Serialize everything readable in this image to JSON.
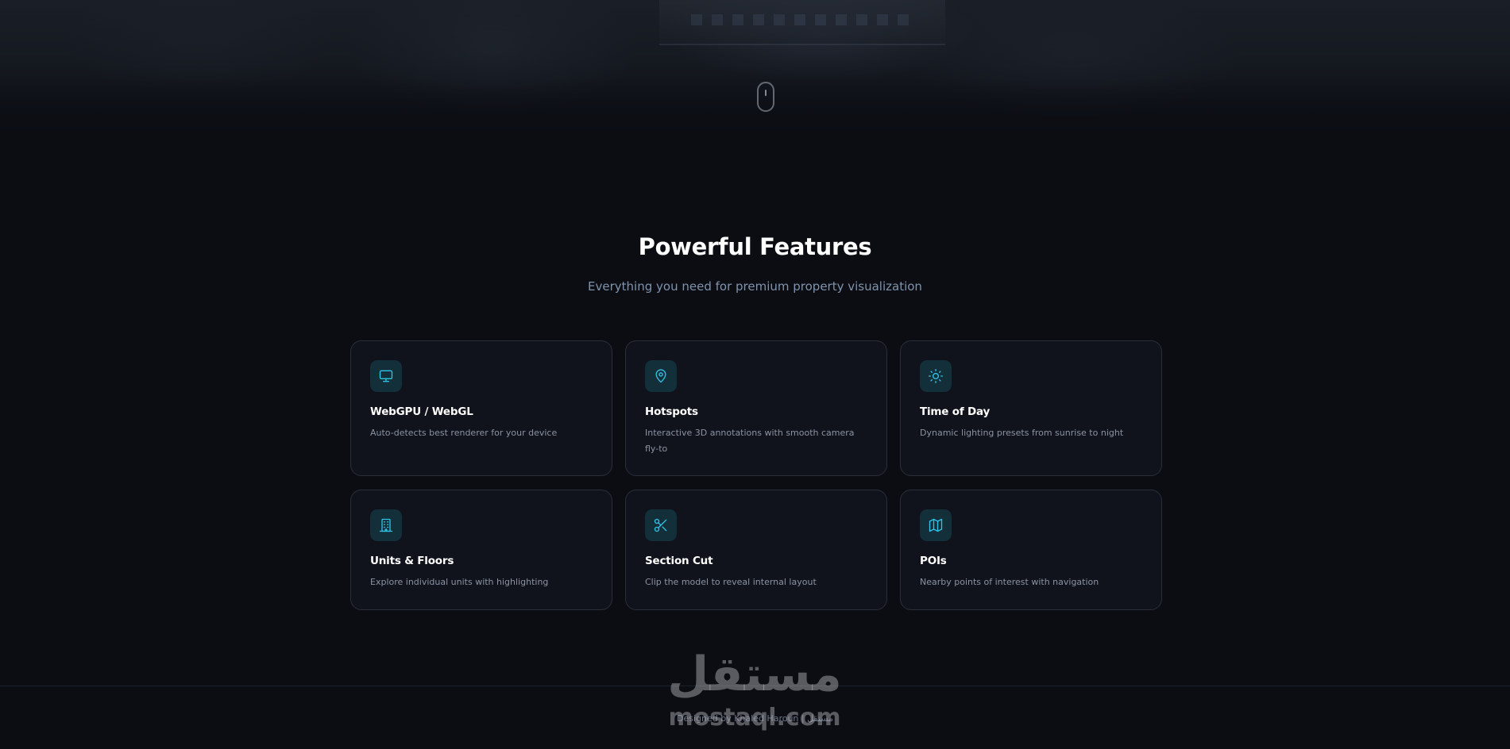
{
  "hero": {
    "scroll_indicator_icon": "mouse-scroll-icon"
  },
  "features": {
    "title": "Powerful Features",
    "subtitle": "Everything you need for premium property visualization",
    "accent_color": "#2ec4e6",
    "items": [
      {
        "icon": "monitor-icon",
        "title": "WebGPU / WebGL",
        "description": "Auto-detects best renderer for your device"
      },
      {
        "icon": "map-pin-icon",
        "title": "Hotspots",
        "description": "Interactive 3D annotations with smooth camera fly-to"
      },
      {
        "icon": "sun-icon",
        "title": "Time of Day",
        "description": "Dynamic lighting presets from sunrise to night"
      },
      {
        "icon": "building-icon",
        "title": "Units & Floors",
        "description": "Explore individual units with highlighting"
      },
      {
        "icon": "scissors-icon",
        "title": "Section Cut",
        "description": "Clip the model to reveal internal layout"
      },
      {
        "icon": "map-icon",
        "title": "POIs",
        "description": "Nearby points of interest with navigation"
      }
    ]
  },
  "footer": {
    "credit": "Designed by Khaled Haroun | مستقل"
  },
  "watermark": {
    "arabic": "مستقل",
    "latin": "mostaql.com"
  }
}
